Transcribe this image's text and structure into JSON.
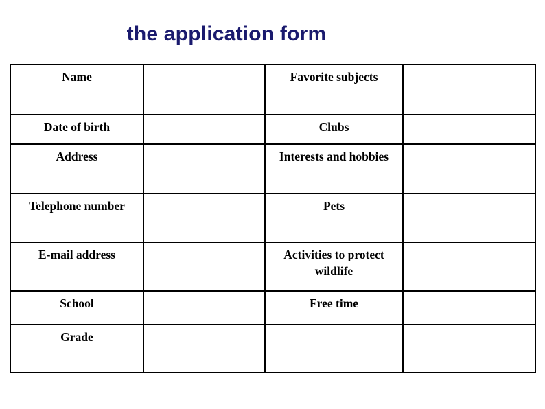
{
  "slide": {
    "title": "the application form",
    "title_color": "#1a1a6e",
    "background_color": "#ffffff",
    "text_color": "#000000",
    "border_color": "#000000"
  },
  "table": {
    "columns": 4,
    "rows": [
      {
        "height": 73,
        "label_left": "Name",
        "value_left": "",
        "label_right": "Favorite subjects",
        "value_right": ""
      },
      {
        "height": 43,
        "label_left": "Date of birth",
        "value_left": "",
        "label_right": "Clubs",
        "value_right": ""
      },
      {
        "height": 72,
        "label_left": "Address",
        "value_left": "",
        "label_right": "Interests and hobbies",
        "value_right": ""
      },
      {
        "height": 71,
        "label_left": "Telephone number",
        "value_left": "",
        "label_right": "Pets",
        "value_right": ""
      },
      {
        "height": 71,
        "label_left": "E-mail address",
        "value_left": "",
        "label_right": "Activities to protect wildlife",
        "value_right": ""
      },
      {
        "height": 49,
        "label_left": "School",
        "value_left": "",
        "label_right": "Free time",
        "value_right": ""
      },
      {
        "height": 70,
        "label_left": "Grade",
        "value_left": "",
        "label_right": "",
        "value_right": ""
      }
    ]
  }
}
